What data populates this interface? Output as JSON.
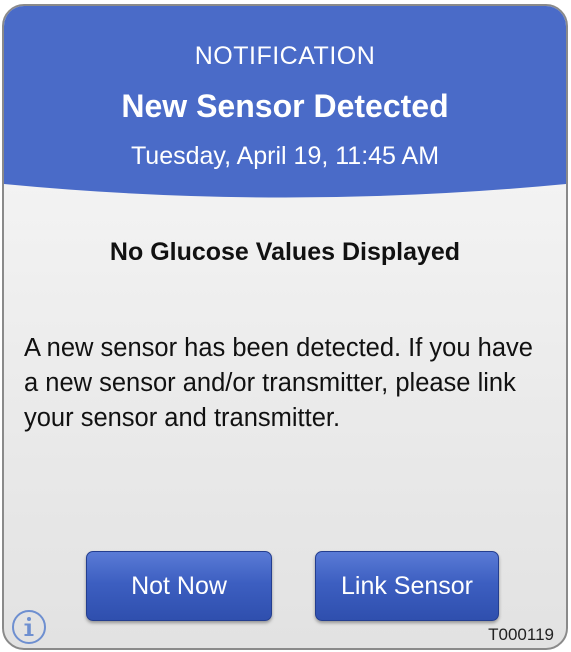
{
  "notification": {
    "label": "NOTIFICATION",
    "title": "New Sensor Detected",
    "datetime": "Tuesday, April 19, 11:45 AM"
  },
  "subtitle": "No Glucose Values Displayed",
  "message": "A new sensor has been detected. If you have a new sensor and/or transmitter, please link your sensor and transmitter.",
  "buttons": {
    "not_now": "Not Now",
    "link_sensor": "Link Sensor"
  },
  "footer": {
    "info_icon": "info-icon",
    "code": "T000119"
  },
  "colors": {
    "header_blue": "#4a6bc8",
    "button_blue": "#3d5fc1",
    "info_icon": "#6e8fd0"
  }
}
